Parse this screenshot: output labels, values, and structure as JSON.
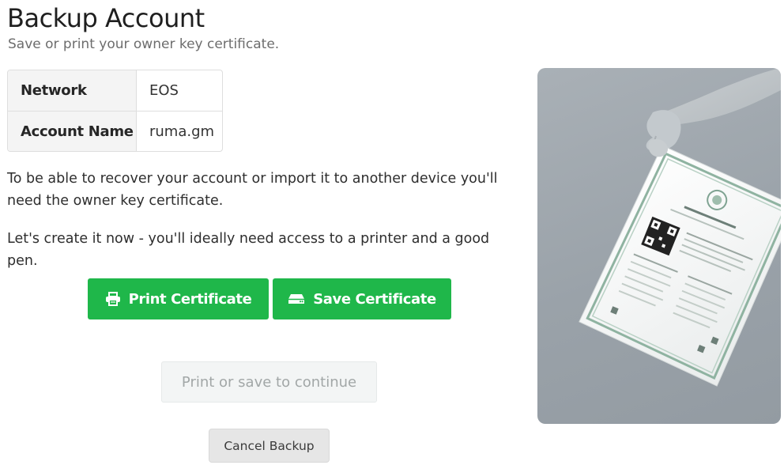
{
  "page": {
    "title": "Backup Account",
    "subtitle": "Save or print your owner key certificate."
  },
  "account_table": {
    "rows": [
      {
        "key": "Network",
        "value": "EOS"
      },
      {
        "key": "Account Name",
        "value": "ruma.gm"
      }
    ]
  },
  "instructions": {
    "line1": "To be able to recover your account or import it to another device you'll need the owner key certificate.",
    "line2": "Let's create it now - you'll ideally need access to a printer and a good pen."
  },
  "actions": {
    "print_label": "Print Certificate",
    "print_icon": "printer-icon",
    "save_label": "Save Certificate",
    "save_icon": "hard-drive-icon",
    "continue_label": "Print or save to continue",
    "cancel_label": "Cancel Backup"
  },
  "colors": {
    "primary_green": "#1fb74a",
    "disabled_text": "#a2a7a7"
  }
}
